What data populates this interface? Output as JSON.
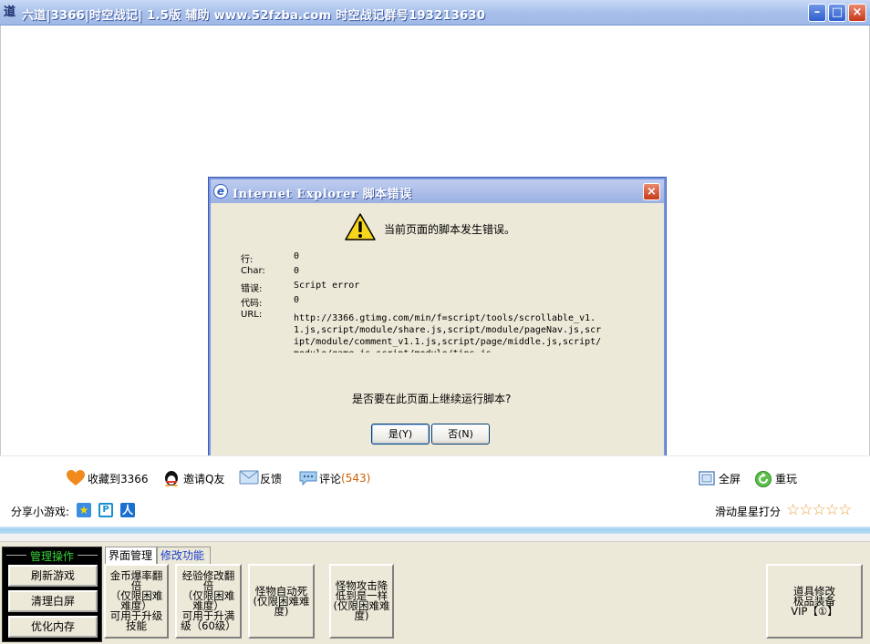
{
  "window": {
    "title": "六道|3366|时空战记|  1.5版 辅助 www.52fzba.com  时空战记群号193213630",
    "icon": "app-icon",
    "controls": {
      "minimize": "minimize-icon",
      "maximize": "maximize-icon",
      "close": "close-icon"
    }
  },
  "dialog": {
    "title": "Internet Explorer 脚本错误",
    "close": "×",
    "message": "当前页面的脚本发生错误。",
    "details": [
      {
        "label": "行:",
        "value": "0"
      },
      {
        "label": "Char:",
        "value": "0"
      },
      {
        "label": "错误:",
        "value": "Script error"
      },
      {
        "label": "代码:",
        "value": "0"
      }
    ],
    "url_label": "URL:",
    "url_value": "http://3366.gtimg.com/min/f=script/tools/scrollable_v1.1.js,script/module/share.js,script/module/pageNav.js,script/module/comment_v1.1.js,script/page/middle.js,script/module/game.js,script/module/tips.js",
    "question": "是否要在此页面上继续运行脚本?",
    "yes_label": "是(Y)",
    "no_label": "否(N)"
  },
  "actions": {
    "favorite": "收藏到3366",
    "invite": "邀请Q友",
    "feedback": "反馈",
    "comment": "评论",
    "comment_count": "(543)",
    "fullscreen": "全屏",
    "replay": "重玩"
  },
  "share": {
    "label": "分享小游戏:",
    "rate_label": "滑动星星打分",
    "stars": "☆☆☆☆☆"
  },
  "panel": {
    "mgmt_title": "管理操作",
    "mgmt_buttons": [
      "刷新游戏",
      "清理白屏",
      "优化内存"
    ],
    "tabs": [
      "界面管理",
      "修改功能"
    ],
    "functions": [
      "金币爆率翻倍\n（仅限困难难度）\n可用于升级技能",
      "经验修改翻倍\n（仅限困难难度）\n可用于升满级（60级）",
      "怪物自动死\n(仅限困难难度)",
      "怪物攻击降低到是一样\n(仅限困难难度)",
      "道具修改\n极品装备\nVIP【①】"
    ]
  },
  "colors": {
    "titlebar": "#a8c0ea",
    "dialog_bg": "#ece9d8",
    "accent_green": "#39d239",
    "tab_active_text": "#1a3ccc",
    "count": "#d06000"
  }
}
